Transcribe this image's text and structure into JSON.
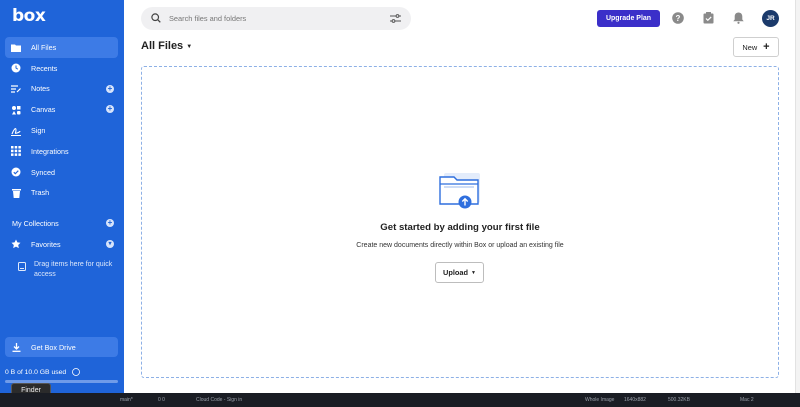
{
  "app": {
    "logo": "box"
  },
  "sidebar": {
    "items": [
      {
        "label": "All Files",
        "icon": "folder-icon",
        "active": true,
        "plus": false
      },
      {
        "label": "Recents",
        "icon": "clock-icon",
        "active": false,
        "plus": false
      },
      {
        "label": "Notes",
        "icon": "notes-icon",
        "active": false,
        "plus": true
      },
      {
        "label": "Canvas",
        "icon": "canvas-icon",
        "active": false,
        "plus": true
      },
      {
        "label": "Sign",
        "icon": "sign-icon",
        "active": false,
        "plus": false
      },
      {
        "label": "Integrations",
        "icon": "grid-icon",
        "active": false,
        "plus": false
      },
      {
        "label": "Synced",
        "icon": "check-circle-icon",
        "active": false,
        "plus": false
      },
      {
        "label": "Trash",
        "icon": "trash-icon",
        "active": false,
        "plus": false
      }
    ],
    "collections_label": "My Collections",
    "favorites_label": "Favorites",
    "drag_hint": "Drag items here for quick access",
    "get_drive_label": "Get Box Drive",
    "storage_text": "0 B of 10.0 GB used",
    "storage_fraction": 0,
    "tooltip": "Finder"
  },
  "topbar": {
    "search_placeholder": "Search files and folders",
    "upgrade_label": "Upgrade Plan",
    "avatar_initials": "JR"
  },
  "main": {
    "title": "All Files",
    "new_label": "New",
    "empty_title": "Get started by adding your first file",
    "empty_subtitle": "Create new documents directly within Box or upload an existing file",
    "upload_label": "Upload"
  },
  "os_strip": {
    "branch": "main*",
    "counts": "0 0",
    "cloud_code": "Cloud Code - Sign in",
    "image_label": "Whole Image",
    "dims": "1640x882",
    "size": "500.32KB",
    "mac": "Mac 2"
  },
  "colors": {
    "sidebar": "#1f64d9",
    "sidebar_active": "#3d7be6",
    "upgrade": "#3b2fc9",
    "avatar": "#1b3a6b"
  }
}
